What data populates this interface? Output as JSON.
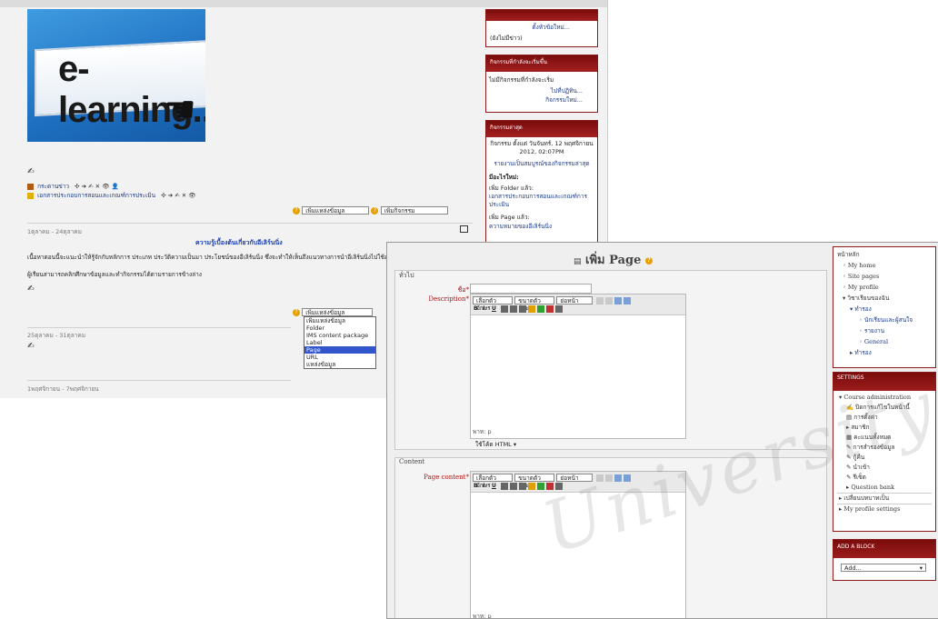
{
  "back": {
    "topbar": "",
    "blocks": {
      "news_link": "ตั้งหัวข้อใหม่...",
      "news_empty": "(ยังไม่มีข่าว)",
      "upcoming_title": "กิจกรรมที่กำลังจะเริ่มขึ้น",
      "upcoming_none": "ไม่มีกิจกรรมที่กำลังจะเริ่ม",
      "upcoming_link1": "ไปที่ปฏิทิน...",
      "upcoming_link2": "กิจกรรมใหม่...",
      "recent_title": "กิจกรรมล่าสุด",
      "recent_date": "กิจกรรม ตั้งแต่ วันจันทร์, 12 พฤศจิกายน 2012, 02:07PM",
      "recent_report": "รายงานเป็นสมบูรณ์ของกิจกรรมล่าสุด",
      "recent_updates": "มีอะไรใหม่:",
      "recent_folder": "เพิ่ม Folder แล้ว:",
      "recent_folder_link": "เอกสารประกอบการสอนและเกณฑ์การประเมิน",
      "recent_page": "เพิ่ม Page แล้ว:",
      "recent_page_link": "ความหมายของอีเลิร์นนิ่ง"
    },
    "banner_text": "e-learning...",
    "resources": [
      "กระดานข่าว",
      "เอกสารประกอบการสอนและเกณฑ์การประเมิน"
    ],
    "add_resource": "เพิ่มแหล่งข้อมูล",
    "add_activity": "เพิ่มกิจกรรม",
    "week1_date": "1ตุลาคม - 24ตุลาคม",
    "week1_title": "ความรู้เบื้องต้นเกี่ยวกับอีเลิร์นนิ่ง",
    "week1_text1": "เนื้อหาตอนนี้จะแนะนำให้รู้จักกับหลักการ ประเภท ประวัติความเป็นมา ประโยชน์ของอีเลิร์นนิ่ง ซึ่งจะทำให้เห็นถึงแนวทางการนำอีเลิร์นนิ่งไปใช้อย่างมี",
    "week1_text2": "ผู้เรียนสามารถคลิกศึกษาข้อมูลและทำกิจกรรมได้ตามรายการข้างล่าง",
    "week2_date": "25ตุลาคม - 31ตุลาคม",
    "week3_date": "1พฤศจิกายน - 7พฤศจิกายน",
    "dropdown": {
      "selected": "เพิ่มแหล่งข้อมูล",
      "options": [
        "เพิ่มแหล่งข้อมูล",
        "Folder",
        "IMS content package",
        "Label",
        "Page",
        "URL",
        "แหล่งข้อมูล"
      ],
      "highlighted": "Page"
    }
  },
  "front": {
    "title": "เพิ่ม Page",
    "general_legend": "ทั่วไป",
    "name_label": "ชื่อ*",
    "description_label": "Description*",
    "font_family": "เลือกตัวอักษร",
    "font_size": "ขนาดตัวอักษร",
    "paragraph": "ย่อหน้า",
    "path": "พาท: p",
    "format": "ใช้โค้ด HTML",
    "content_legend": "Content",
    "page_content_label": "Page content*",
    "nav": {
      "header": "หน้าหลัก",
      "items": [
        "My home",
        "Site pages",
        "My profile",
        "วิชาเรียนของฉัน",
        "ทำรอง",
        "นักเรียนและผู้สนใจ",
        "รายงาน",
        "General",
        "ทำรอง"
      ]
    },
    "settings": {
      "header": "SETTINGS",
      "items": [
        "Course administration",
        "ปิดการแก้ไขในหน้านี้",
        "การตั้งค่า",
        "สมาชิก",
        "คะแนนทั้งหมด",
        "การสำรองข้อมูล",
        "กู้คืน",
        "นำเข้า",
        "รีเซ็ต",
        "Question bank",
        "เปลี่ยนบทบาทเป็น",
        "My profile settings"
      ]
    },
    "add_block": {
      "header": "ADD A BLOCK",
      "select": "Add..."
    }
  },
  "watermark": "University"
}
